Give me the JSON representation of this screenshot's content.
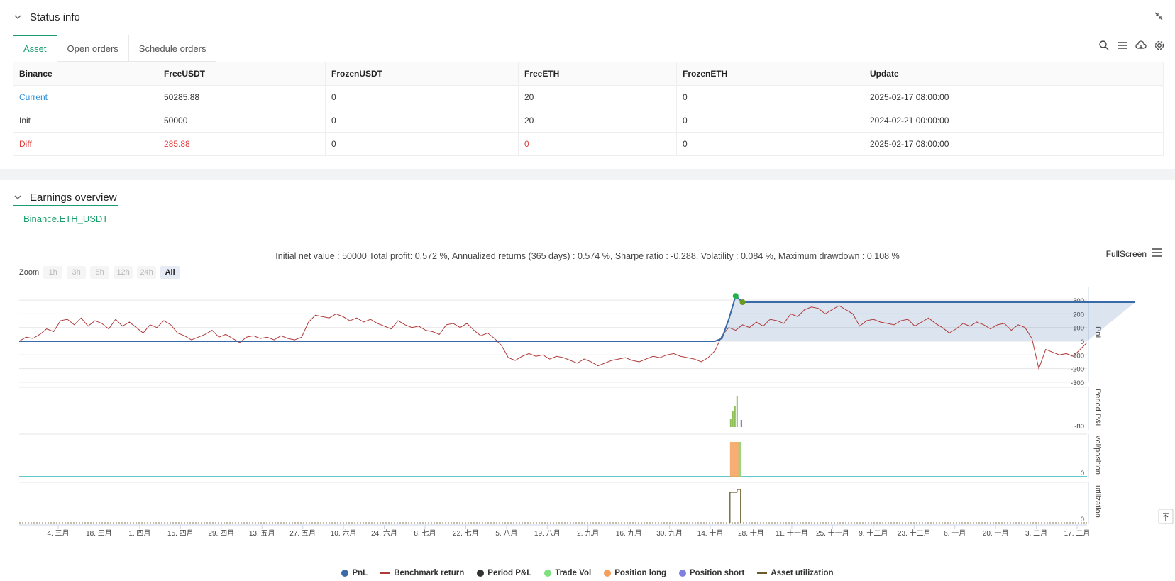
{
  "status": {
    "title": "Status info",
    "tabs": [
      "Asset",
      "Open orders",
      "Schedule orders"
    ],
    "table": {
      "headers": [
        "Binance",
        "FreeUSDT",
        "FrozenUSDT",
        "FreeETH",
        "FrozenETH",
        "Update"
      ],
      "rows": [
        [
          "Current",
          "50285.88",
          "0",
          "20",
          "0",
          "2025-02-17 08:00:00"
        ],
        [
          "Init",
          "50000",
          "0",
          "20",
          "0",
          "2024-02-21 00:00:00"
        ],
        [
          "Diff",
          "285.88",
          "0",
          "0",
          "0",
          "2025-02-17 08:00:00"
        ]
      ]
    }
  },
  "earnings": {
    "title": "Earnings overview",
    "tab": "Binance.ETH_USDT",
    "summary": "Initial net value : 50000 Total profit: 0.572 %, Annualized returns (365 days) : 0.574 %, Sharpe ratio : -0.288, Volatility : 0.084 %, Maximum drawdown : 0.108 %",
    "fullscreen_label": "FullScreen",
    "zoom_label": "Zoom",
    "zoom_options": [
      "1h",
      "3h",
      "8h",
      "12h",
      "24h",
      "All"
    ],
    "legend": [
      "PnL",
      "Benchmark return",
      "Period P&L",
      "Trade Vol",
      "Position long",
      "Position short",
      "Asset utilization"
    ]
  },
  "colors": {
    "accent": "#1a9e6e",
    "pnl": "#3a6aa8",
    "benchmark": "#b03a3a",
    "period": "#333333",
    "trade_vol": "#7ee07e",
    "pos_long": "#f5a05a",
    "pos_short": "#8080e0",
    "util": "#6b5a2a"
  },
  "chart_data": {
    "type": "line",
    "x_ticks": [
      "4. 三月",
      "18. 三月",
      "1. 四月",
      "15. 四月",
      "29. 四月",
      "13. 五月",
      "27. 五月",
      "10. 六月",
      "24. 六月",
      "8. 七月",
      "22. 七月",
      "5. 八月",
      "19. 八月",
      "2. 九月",
      "16. 九月",
      "30. 九月",
      "14. 十月",
      "28. 十月",
      "11. 十一月",
      "25. 十一月",
      "9. 十二月",
      "23. 十二月",
      "6. 一月",
      "20. 一月",
      "3. 二月",
      "17. 二月"
    ],
    "pnl_axis": {
      "label": "PnL",
      "ticks": [
        300,
        200,
        100,
        0,
        -100,
        -200,
        -300
      ],
      "ylim": [
        -300,
        300
      ]
    },
    "period_axis": {
      "label": "Period P&L",
      "ticks": [
        -80
      ]
    },
    "vol_axis": {
      "label": "vol/position",
      "ticks": [
        0
      ]
    },
    "util_axis": {
      "label": "utilization",
      "ticks": [
        0
      ]
    },
    "benchmark": [
      0,
      30,
      20,
      50,
      90,
      70,
      150,
      160,
      120,
      170,
      110,
      150,
      130,
      90,
      160,
      110,
      140,
      100,
      60,
      120,
      100,
      150,
      120,
      60,
      40,
      10,
      30,
      50,
      80,
      30,
      50,
      20,
      -10,
      30,
      40,
      20,
      30,
      10,
      40,
      20,
      10,
      30,
      140,
      190,
      180,
      170,
      200,
      180,
      150,
      170,
      140,
      160,
      130,
      110,
      90,
      150,
      120,
      100,
      110,
      80,
      70,
      50,
      120,
      130,
      100,
      130,
      80,
      40,
      60,
      20,
      -30,
      -120,
      -140,
      -110,
      -90,
      -110,
      -100,
      -130,
      -110,
      -120,
      -140,
      -160,
      -130,
      -150,
      -180,
      -160,
      -140,
      -130,
      -120,
      -140,
      -150,
      -130,
      -110,
      -120,
      -100,
      -90,
      -110,
      -120,
      -130,
      -150,
      -120,
      -70,
      40,
      100,
      80,
      120,
      100,
      140,
      110,
      160,
      150,
      130,
      200,
      180,
      230,
      250,
      240,
      200,
      230,
      260,
      230,
      200,
      110,
      150,
      160,
      140,
      130,
      120,
      150,
      160,
      110,
      140,
      170,
      130,
      100,
      60,
      90,
      130,
      110,
      140,
      120,
      90,
      120,
      130,
      80,
      120,
      100,
      20,
      -200,
      -60,
      -80,
      -100,
      -90,
      -110,
      -60,
      -10
    ],
    "pnl": [
      0,
      0,
      0,
      0,
      0,
      0,
      0,
      0,
      0,
      0,
      0,
      0,
      0,
      0,
      0,
      0,
      0,
      0,
      0,
      0,
      0,
      0,
      0,
      0,
      0,
      0,
      0,
      0,
      0,
      0,
      0,
      0,
      0,
      0,
      0,
      0,
      0,
      0,
      0,
      0,
      0,
      0,
      0,
      0,
      0,
      0,
      0,
      0,
      0,
      0,
      0,
      0,
      0,
      0,
      0,
      0,
      0,
      0,
      0,
      0,
      0,
      0,
      0,
      0,
      0,
      0,
      0,
      0,
      0,
      0,
      0,
      0,
      0,
      0,
      0,
      0,
      0,
      0,
      0,
      0,
      0,
      0,
      0,
      0,
      0,
      0,
      0,
      0,
      0,
      0,
      0,
      0,
      0,
      0,
      0,
      0,
      0,
      0,
      0,
      0,
      0,
      0,
      20,
      160,
      330,
      285,
      285,
      285,
      285,
      285,
      285,
      285,
      285,
      285,
      285,
      285,
      285,
      285,
      285,
      285,
      285,
      285,
      285,
      285,
      285,
      285,
      285,
      285,
      285,
      285,
      285,
      285,
      285,
      285,
      285,
      285,
      285,
      285,
      285,
      285,
      285,
      285,
      285,
      285,
      285,
      285,
      285,
      285,
      285,
      285,
      285,
      285,
      285,
      285,
      285,
      285,
      285,
      285,
      285,
      285,
      285,
      285,
      285
    ]
  }
}
